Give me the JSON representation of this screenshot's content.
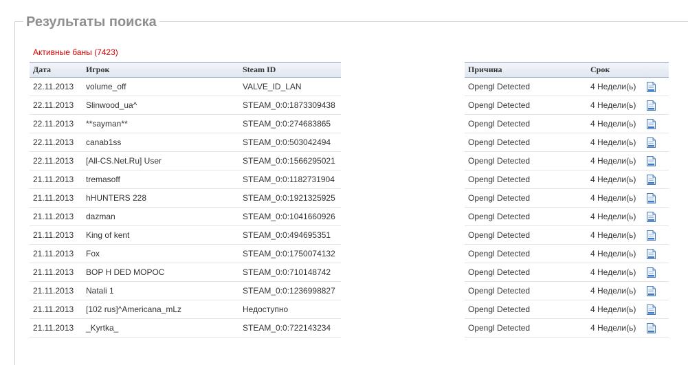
{
  "page": {
    "legend": "Результаты поиска",
    "active_bans": "Активные баны (7423)"
  },
  "left_table": {
    "headers": [
      "Дата",
      "Игрок",
      "Steam ID"
    ],
    "rows": [
      [
        "22.11.2013",
        "volume_off",
        "VALVE_ID_LAN"
      ],
      [
        "22.11.2013",
        "Slinwood_ua^",
        "STEAM_0:0:1873309438"
      ],
      [
        "22.11.2013",
        "**sayman**",
        "STEAM_0:0:274683865"
      ],
      [
        "22.11.2013",
        "canab1ss",
        "STEAM_0:0:503042494"
      ],
      [
        "22.11.2013",
        "[All-CS.Net.Ru] User",
        "STEAM_0:0:1566295021"
      ],
      [
        "21.11.2013",
        "tremasoff",
        "STEAM_0:0:1182731904"
      ],
      [
        "21.11.2013",
        "hHUNTERS 228",
        "STEAM_0:0:1921325925"
      ],
      [
        "21.11.2013",
        "dazman",
        "STEAM_0:0:1041660926"
      ],
      [
        "21.11.2013",
        "King of kent",
        "STEAM_0:0:494695351"
      ],
      [
        "21.11.2013",
        "Fox",
        "STEAM_0:0:1750074132"
      ],
      [
        "21.11.2013",
        "BOP H DED MOPOC",
        "STEAM_0:0:710148742"
      ],
      [
        "21.11.2013",
        "Natali 1",
        "STEAM_0:0:1236998827"
      ],
      [
        "21.11.2013",
        "[102 rus]^Americana_mLz",
        "Недоступно"
      ],
      [
        "21.11.2013",
        "_Kyrtka_",
        "STEAM_0:0:722143234"
      ]
    ]
  },
  "right_table": {
    "headers": [
      "Причина",
      "Срок",
      ""
    ],
    "rows": [
      [
        "Opengl Detected",
        "4 Недели(ь)"
      ],
      [
        "Opengl Detected",
        "4 Недели(ь)"
      ],
      [
        "Opengl Detected",
        "4 Недели(ь)"
      ],
      [
        "Opengl Detected",
        "4 Недели(ь)"
      ],
      [
        "Opengl Detected",
        "4 Недели(ь)"
      ],
      [
        "Opengl Detected",
        "4 Недели(ь)"
      ],
      [
        "Opengl Detected",
        "4 Недели(ь)"
      ],
      [
        "Opengl Detected",
        "4 Недели(ь)"
      ],
      [
        "Opengl Detected",
        "4 Недели(ь)"
      ],
      [
        "Opengl Detected",
        "4 Недели(ь)"
      ],
      [
        "Opengl Detected",
        "4 Недели(ь)"
      ],
      [
        "Opengl Detected",
        "4 Недели(ь)"
      ],
      [
        "Opengl Detected",
        "4 Недели(ь)"
      ],
      [
        "Opengl Detected",
        "4 Недели(ь)"
      ]
    ],
    "row_icon": "document-details-icon"
  },
  "colors": {
    "legend": "#8f8f8f",
    "active_bans": "#d40000",
    "header_border": "#9aa9c4",
    "row_border": "#e3e3e3"
  }
}
